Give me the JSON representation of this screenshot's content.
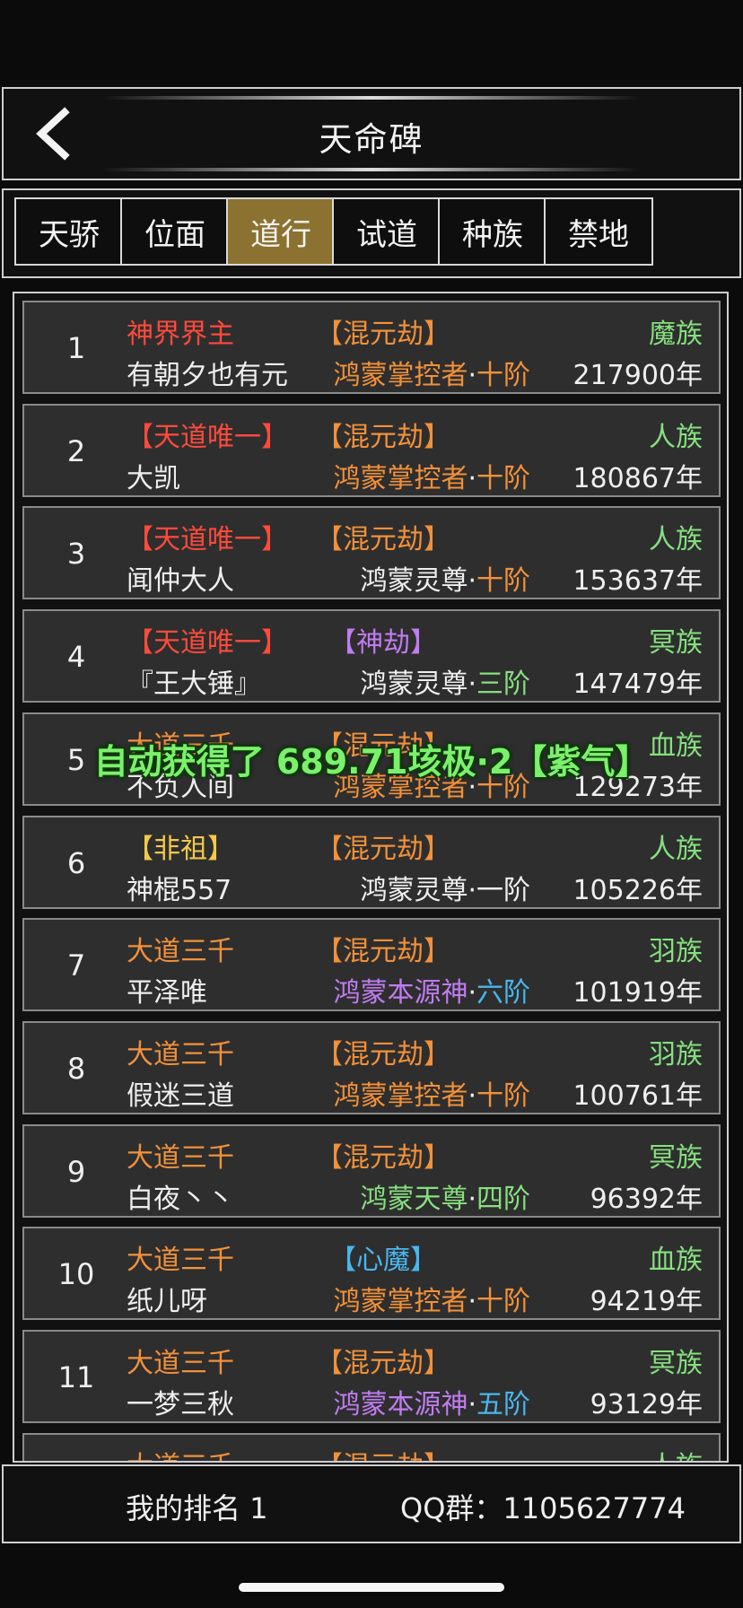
{
  "colors": {
    "red": "#ff4a3c",
    "orange": "#f2913a",
    "yellow": "#f3c84b",
    "green": "#86e07f",
    "purple": "#c07cf0",
    "blue": "#49b6ee",
    "white": "#efefef",
    "tab_active": "#8b7230"
  },
  "header": {
    "back_icon": "chevron-left-icon",
    "title": "天命碑"
  },
  "tabs": [
    {
      "label": "天骄",
      "active": false
    },
    {
      "label": "位面",
      "active": false
    },
    {
      "label": "道行",
      "active": true
    },
    {
      "label": "试道",
      "active": false
    },
    {
      "label": "种族",
      "active": false
    },
    {
      "label": "禁地",
      "active": false
    }
  ],
  "rankings": [
    {
      "rank": "1",
      "title": "神界界主",
      "title_color": "red",
      "tribulation": "【混元劫】",
      "tribulation_color": "orange",
      "race": "魔族",
      "name": "有朝夕也有元",
      "realm": "鸿蒙掌控者",
      "realm_color": "orange",
      "stage": "十阶",
      "stage_color": "orange",
      "years": "217900年"
    },
    {
      "rank": "2",
      "title": "【天道唯一】",
      "title_color": "red",
      "tribulation": "【混元劫】",
      "tribulation_color": "orange",
      "race": "人族",
      "name": "大凯",
      "realm": "鸿蒙掌控者",
      "realm_color": "orange",
      "stage": "十阶",
      "stage_color": "orange",
      "years": "180867年"
    },
    {
      "rank": "3",
      "title": "【天道唯一】",
      "title_color": "red",
      "tribulation": "【混元劫】",
      "tribulation_color": "orange",
      "race": "人族",
      "name": "闻仲大人",
      "realm": "鸿蒙灵尊",
      "realm_color": "white",
      "stage": "十阶",
      "stage_color": "orange",
      "years": "153637年"
    },
    {
      "rank": "4",
      "title": "【天道唯一】",
      "title_color": "red",
      "tribulation": "【神劫】",
      "tribulation_color": "purple",
      "race": "冥族",
      "name": "『王大锤』",
      "realm": "鸿蒙灵尊",
      "realm_color": "white",
      "stage": "三阶",
      "stage_color": "green",
      "years": "147479年"
    },
    {
      "rank": "5",
      "title": "大道三千",
      "title_color": "orange",
      "tribulation": "【混元劫】",
      "tribulation_color": "orange",
      "race": "血族",
      "name": "不负人间",
      "realm": "鸿蒙掌控者",
      "realm_color": "orange",
      "stage": "十阶",
      "stage_color": "orange",
      "years": "129273年"
    },
    {
      "rank": "6",
      "title": "【非祖】",
      "title_color": "yellow",
      "tribulation": "【混元劫】",
      "tribulation_color": "orange",
      "race": "人族",
      "name": "神棍557",
      "realm": "鸿蒙灵尊",
      "realm_color": "white",
      "stage": "一阶",
      "stage_color": "white",
      "years": "105226年"
    },
    {
      "rank": "7",
      "title": "大道三千",
      "title_color": "orange",
      "tribulation": "【混元劫】",
      "tribulation_color": "orange",
      "race": "羽族",
      "name": "平泽唯",
      "realm": "鸿蒙本源神",
      "realm_color": "purple",
      "stage": "六阶",
      "stage_color": "blue",
      "years": "101919年"
    },
    {
      "rank": "8",
      "title": "大道三千",
      "title_color": "orange",
      "tribulation": "【混元劫】",
      "tribulation_color": "orange",
      "race": "羽族",
      "name": "假迷三道",
      "realm": "鸿蒙掌控者",
      "realm_color": "orange",
      "stage": "十阶",
      "stage_color": "orange",
      "years": "100761年"
    },
    {
      "rank": "9",
      "title": "大道三千",
      "title_color": "orange",
      "tribulation": "【混元劫】",
      "tribulation_color": "orange",
      "race": "冥族",
      "name": "白夜丶丶",
      "realm": "鸿蒙天尊",
      "realm_color": "green",
      "stage": "四阶",
      "stage_color": "green",
      "years": "96392年"
    },
    {
      "rank": "10",
      "title": "大道三千",
      "title_color": "orange",
      "tribulation": "【心魔】",
      "tribulation_color": "blue",
      "race": "血族",
      "name": "纸儿呀",
      "realm": "鸿蒙掌控者",
      "realm_color": "orange",
      "stage": "十阶",
      "stage_color": "orange",
      "years": "94219年"
    },
    {
      "rank": "11",
      "title": "大道三千",
      "title_color": "orange",
      "tribulation": "【混元劫】",
      "tribulation_color": "orange",
      "race": "冥族",
      "name": "一梦三秋",
      "realm": "鸿蒙本源神",
      "realm_color": "purple",
      "stage": "五阶",
      "stage_color": "blue",
      "years": "93129年"
    },
    {
      "rank": "",
      "title": "大道三千",
      "title_color": "orange",
      "tribulation": "【混元劫】",
      "tribulation_color": "orange",
      "race": "人族",
      "name": "",
      "realm": "",
      "realm_color": "white",
      "stage": "",
      "stage_color": "white",
      "years": ""
    }
  ],
  "toast": "自动获得了 689.71垓极·2【紫气】",
  "footer": {
    "my_rank": "我的排名 1",
    "qq_group": "QQ群：1105627774"
  }
}
